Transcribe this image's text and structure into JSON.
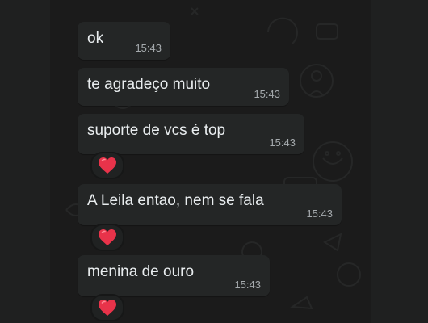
{
  "messages": [
    {
      "text": "ok",
      "time": "15:43",
      "reaction": null
    },
    {
      "text": "te agradeço muito",
      "time": "15:43",
      "reaction": null
    },
    {
      "text": "suporte de vcs é top",
      "time": "15:43",
      "reaction": "heart-icon"
    },
    {
      "text": "A Leila entao, nem se fala",
      "time": "15:43",
      "reaction": "heart-icon"
    },
    {
      "text": "menina de ouro",
      "time": "15:43",
      "reaction": "heart-icon"
    }
  ],
  "colors": {
    "background": "#161717",
    "bubble": "#242626",
    "text": "#e9edef",
    "time": "#a5aaad",
    "heart": "#e8334a"
  }
}
